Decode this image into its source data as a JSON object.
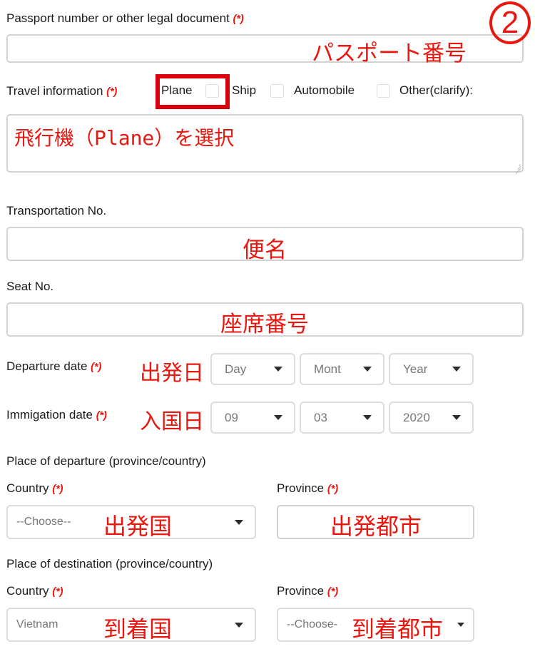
{
  "annotations": {
    "step_number": "2",
    "passport": "パスポート番号",
    "plane_select": "飛行機（Plane）を選択",
    "transport_no": "便名",
    "seat_no": "座席番号",
    "departure_date": "出発日",
    "immigration_date": "入国日",
    "departure_country": "出発国",
    "departure_province": "出発都市",
    "destination_country": "到着国",
    "destination_province": "到着都市",
    "color": "#e8170f",
    "highlight_color": "#d9000b"
  },
  "passport_section": {
    "label": "Passport number or other legal document",
    "required_mark": "(*)",
    "value": "",
    "placeholder": ""
  },
  "travel_info": {
    "label": "Travel information",
    "required_mark": "(*)",
    "options": [
      {
        "label": "Plane",
        "checked": false,
        "highlighted": true
      },
      {
        "label": "Ship",
        "checked": false,
        "highlighted": false
      },
      {
        "label": "Automobile",
        "checked": false,
        "highlighted": false
      }
    ],
    "other_label": "Other(clarify):",
    "other_value": ""
  },
  "transportation": {
    "label": "Transportation No.",
    "value": ""
  },
  "seat": {
    "label": "Seat No.",
    "value": ""
  },
  "departure_date": {
    "label": "Departure date",
    "required_mark": "(*)",
    "day": "Day",
    "month": "Month",
    "year": "Year"
  },
  "immigration_date": {
    "label": "Immigation date",
    "required_mark": "(*)",
    "day": "09",
    "month": "03",
    "year": "2020"
  },
  "place_of_departure": {
    "heading": "Place of departure (province/country)",
    "country_label": "Country",
    "country_required": "(*)",
    "country_value": "--Choose--",
    "province_label": "Province",
    "province_required": "(*)",
    "province_value": ""
  },
  "place_of_destination": {
    "heading": "Place of destination (province/country)",
    "country_label": "Country",
    "country_required": "(*)",
    "country_value": "Vietnam",
    "province_label": "Province",
    "province_required": "(*)",
    "province_value": "--Choose-"
  }
}
